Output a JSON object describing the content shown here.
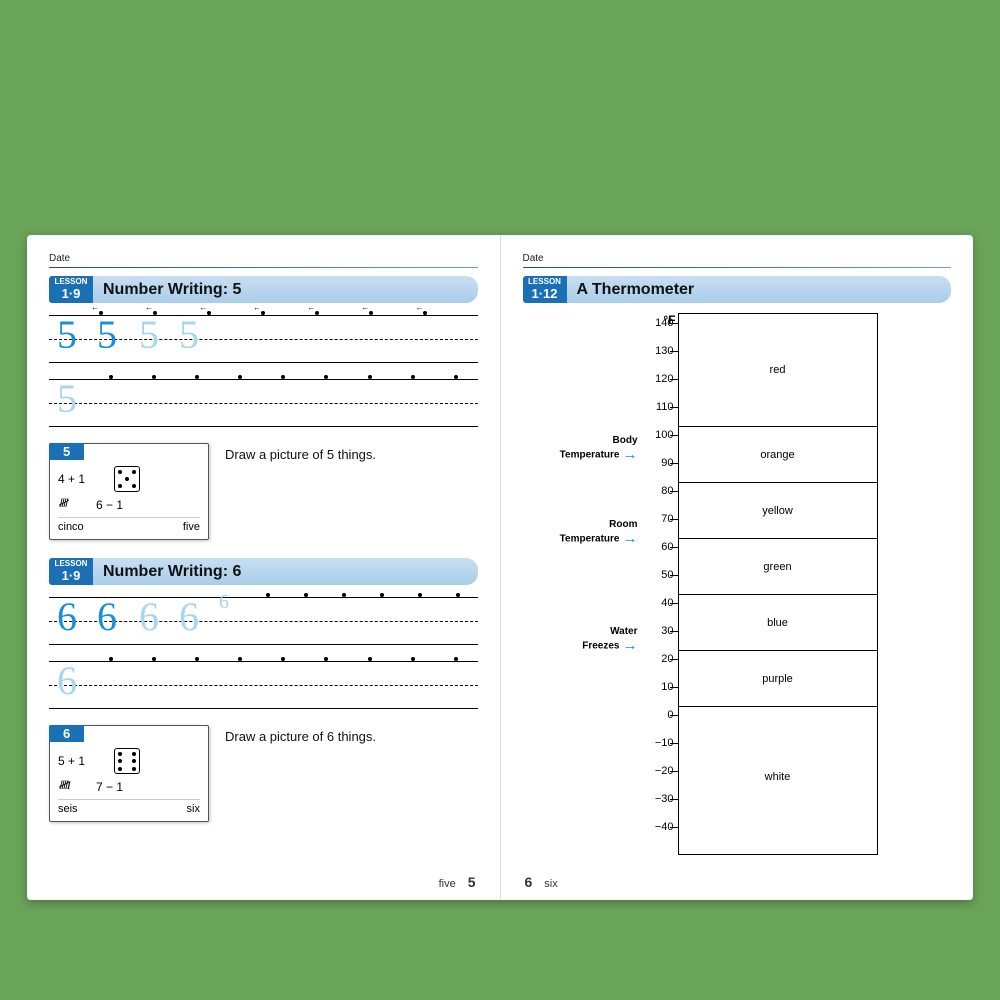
{
  "left": {
    "date_label": "Date",
    "section1": {
      "lesson_tag": "LESSON",
      "lesson_num": "1·9",
      "title": "Number Writing: 5",
      "guide_digit": "5",
      "card": {
        "num": "5",
        "eq1": "4 + 1",
        "eq2": "6 − 1",
        "tally": "HH",
        "spanish": "cinco",
        "english": "five"
      },
      "prompt": "Draw a picture of 5 things."
    },
    "section2": {
      "lesson_tag": "LESSON",
      "lesson_num": "1·9",
      "title": "Number Writing: 6",
      "guide_digit": "6",
      "card": {
        "num": "6",
        "eq1": "5 + 1",
        "eq2": "7 − 1",
        "tally": "HH I",
        "spanish": "seis",
        "english": "six"
      },
      "prompt": "Draw a picture of 6 things."
    },
    "footer_word": "five",
    "footer_num": "5"
  },
  "right": {
    "date_label": "Date",
    "lesson_tag": "LESSON",
    "lesson_num": "1·12",
    "title": "A Thermometer",
    "unit": "°F",
    "ticks": [
      "140",
      "130",
      "120",
      "110",
      "100",
      "90",
      "80",
      "70",
      "60",
      "50",
      "40",
      "30",
      "20",
      "10",
      "0",
      "−10",
      "−20",
      "−30",
      "−40"
    ],
    "callouts": {
      "body": "Body\nTemperature",
      "room": "Room\nTemperature",
      "freeze": "Water\nFreezes"
    },
    "zones": [
      {
        "label": "red",
        "span": 4
      },
      {
        "label": "orange",
        "span": 2
      },
      {
        "label": "yellow",
        "span": 2
      },
      {
        "label": "green",
        "span": 2
      },
      {
        "label": "blue",
        "span": 2
      },
      {
        "label": "purple",
        "span": 2
      },
      {
        "label": "white",
        "span": 5
      }
    ],
    "footer_num": "6",
    "footer_word": "six"
  },
  "chart_data": {
    "type": "table",
    "title": "A Thermometer",
    "unit": "°F",
    "scale_ticks": [
      140,
      130,
      120,
      110,
      100,
      90,
      80,
      70,
      60,
      50,
      40,
      30,
      20,
      10,
      0,
      -10,
      -20,
      -30,
      -40
    ],
    "reference_points": [
      {
        "label": "Body Temperature",
        "value": 100
      },
      {
        "label": "Room Temperature",
        "value": 70
      },
      {
        "label": "Water Freezes",
        "value": 32
      }
    ],
    "color_zones": [
      {
        "color": "red",
        "range": [
          100,
          140
        ]
      },
      {
        "color": "orange",
        "range": [
          80,
          100
        ]
      },
      {
        "color": "yellow",
        "range": [
          60,
          80
        ]
      },
      {
        "color": "green",
        "range": [
          40,
          60
        ]
      },
      {
        "color": "blue",
        "range": [
          20,
          40
        ]
      },
      {
        "color": "purple",
        "range": [
          0,
          20
        ]
      },
      {
        "color": "white",
        "range": [
          -40,
          0
        ]
      }
    ]
  }
}
